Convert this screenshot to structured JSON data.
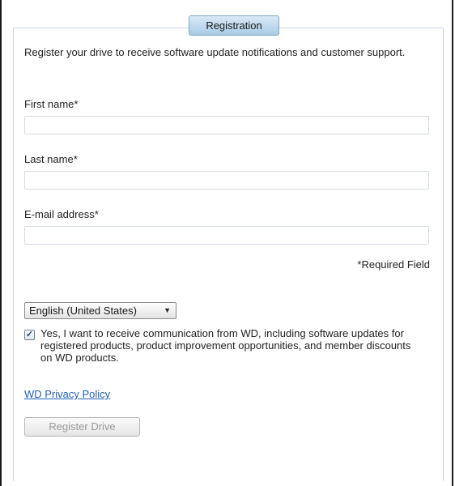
{
  "tab": {
    "label": "Registration"
  },
  "intro": "Register your drive to receive software update notifications and customer support.",
  "form": {
    "first_name": {
      "label": "First name*",
      "value": ""
    },
    "last_name": {
      "label": "Last name*",
      "value": ""
    },
    "email": {
      "label": "E-mail address*",
      "value": ""
    },
    "required_note": "*Required Field"
  },
  "language": {
    "selected": "English (United States)"
  },
  "consent": {
    "checked": true,
    "text": "Yes, I want to receive communication from WD, including software updates for registered products, product improvement opportunities, and member discounts on WD products."
  },
  "privacy_link": "WD Privacy Policy",
  "register_button": {
    "label": "Register Drive",
    "enabled": false
  },
  "colors": {
    "link": "#1f5fbf",
    "tab_bg": "#a9cbe6",
    "disabled_text": "#9a9a9a"
  }
}
